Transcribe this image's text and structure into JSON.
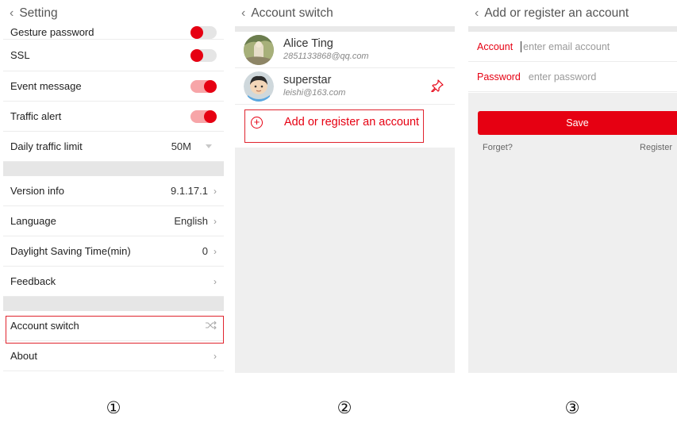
{
  "setting": {
    "title": "Setting",
    "rows": {
      "gesture": "Gesture password",
      "ssl": "SSL",
      "event": "Event message",
      "traffic_alert": "Traffic alert",
      "daily_limit": "Daily traffic limit",
      "daily_limit_value": "50M",
      "version": "Version info",
      "version_value": "9.1.17.1",
      "language": "Language",
      "language_value": "English",
      "dst": "Daylight Saving Time(min)",
      "dst_value": "0",
      "feedback": "Feedback",
      "account_switch": "Account switch",
      "about": "About"
    },
    "toggles": {
      "gesture": false,
      "ssl": false,
      "event": true,
      "traffic_alert": true
    }
  },
  "account_switch": {
    "title": "Account switch",
    "accounts": [
      {
        "name": "Alice Ting",
        "email": "2851133868@qq.com"
      },
      {
        "name": "superstar",
        "email": "leishi@163.com"
      }
    ],
    "add_label": "Add or register an account"
  },
  "register": {
    "title": "Add or register an account",
    "account_label": "Account",
    "account_placeholder": "enter email account",
    "password_label": "Password",
    "password_placeholder": "enter password",
    "save_label": "Save",
    "forget_label": "Forget?",
    "register_label": "Register"
  },
  "steps": [
    "①",
    "②",
    "③"
  ],
  "colors": {
    "accent": "#e60012",
    "highlight": "#e0242e",
    "divider": "#e6e6e6"
  },
  "icons": [
    "back-chevron-icon",
    "chevron-right-icon",
    "shuffle-icon",
    "pin-icon",
    "plus-circle-icon"
  ]
}
